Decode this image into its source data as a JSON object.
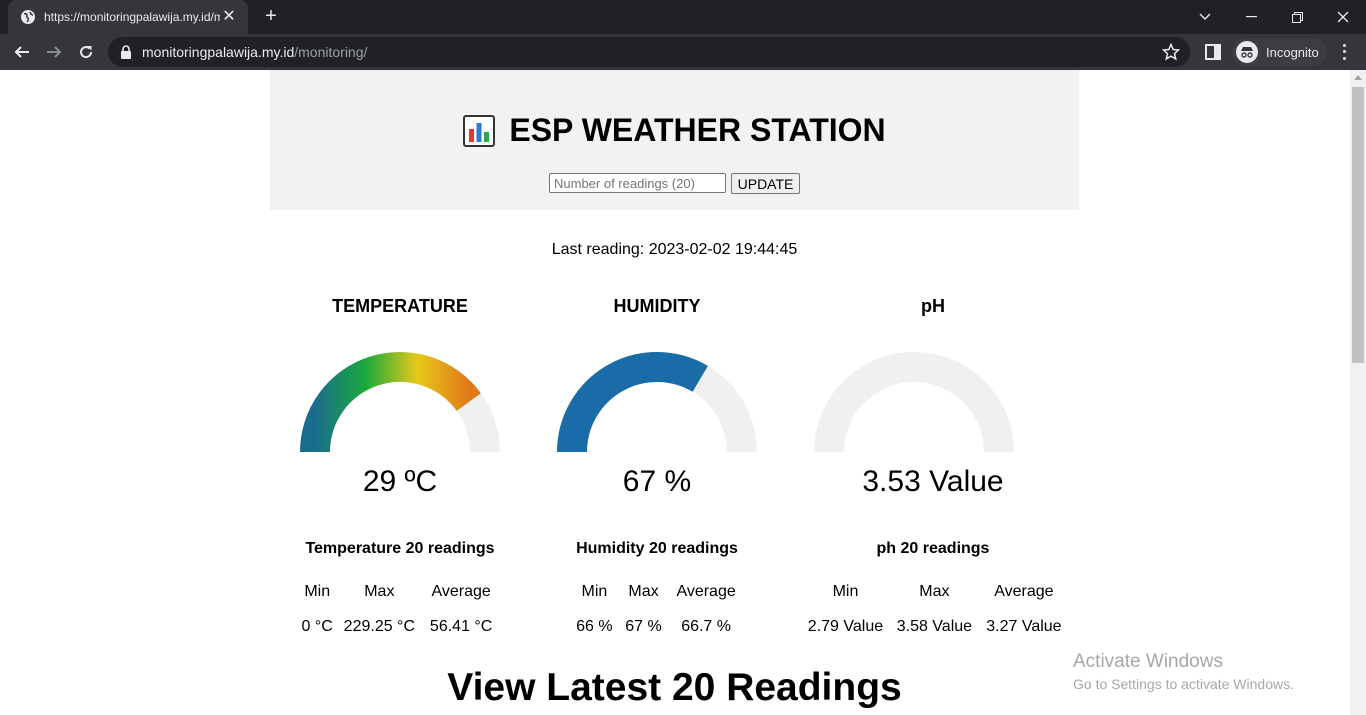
{
  "browser": {
    "tab_title": "https://monitoringpalawija.my.id/monitoring/",
    "url_host": "monitoringpalawija.my.id",
    "url_path": "/monitoring/",
    "profile_label": "Incognito"
  },
  "page": {
    "title": "ESP WEATHER STATION",
    "readings_input": {
      "placeholder": "Number of readings (20)",
      "value": ""
    },
    "update_label": "UPDATE",
    "last_reading": "Last reading: 2023-02-02 19:44:45",
    "view_latest": "View Latest 20 Readings"
  },
  "cards": {
    "temperature": {
      "title": "TEMPERATURE",
      "value_text": "29 ºC",
      "gauge_fraction": 0.8,
      "stats_title": "Temperature 20 readings",
      "min_label": "Min",
      "max_label": "Max",
      "avg_label": "Average",
      "min": "0 °C",
      "max": "229.25 °C",
      "avg": "56.41 °C"
    },
    "humidity": {
      "title": "HUMIDITY",
      "value_text": "67 %",
      "gauge_fraction": 0.67,
      "stats_title": "Humidity 20 readings",
      "min_label": "Min",
      "max_label": "Max",
      "avg_label": "Average",
      "min": "66 %",
      "max": "67 %",
      "avg": "66.7 %"
    },
    "ph": {
      "title": "pH",
      "value_text": "3.53 Value",
      "gauge_fraction": 0,
      "stats_title": "ph 20 readings",
      "min_label": "Min",
      "max_label": "Max",
      "avg_label": "Average",
      "min": "2.79 Value",
      "max": "3.58 Value",
      "avg": "3.27 Value"
    }
  },
  "colors": {
    "humidity_gauge": "#1a6ca8",
    "gauge_track": "#f0f0f0",
    "temperature_gradient": [
      "#1a6c8e",
      "#1aaa3a",
      "#e8c81a",
      "#e07a1a"
    ]
  },
  "watermark": {
    "line1": "Activate Windows",
    "line2": "Go to Settings to activate Windows."
  }
}
